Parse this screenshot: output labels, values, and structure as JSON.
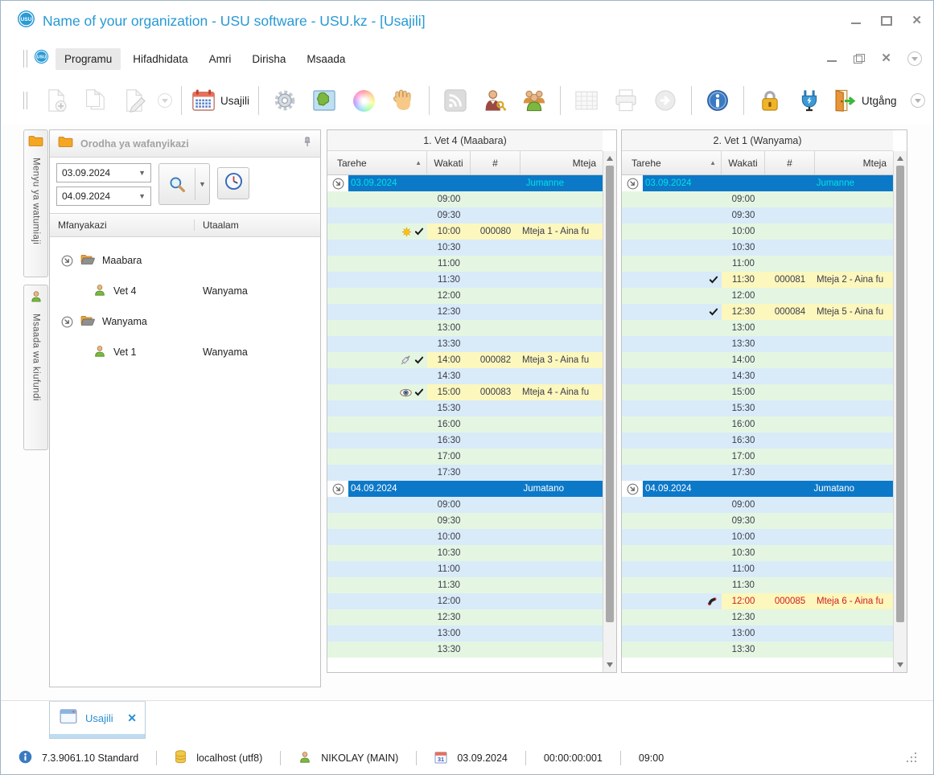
{
  "window": {
    "title": "Name of your organization - USU software - USU.kz - [Usajili]"
  },
  "menubar": {
    "items": [
      "Programu",
      "Hifadhidata",
      "Amri",
      "Dirisha",
      "Msaada"
    ],
    "active": "Programu"
  },
  "toolbar": {
    "usajili_label": "Usajili",
    "exit_label": "Utgång"
  },
  "vertical_tabs": [
    "Menyu ya watumiaji",
    "Msaada wa kiufundi"
  ],
  "sidebar": {
    "title": "Orodha ya wafanyikazi",
    "date_from": "03.09.2024",
    "date_to": "04.09.2024",
    "columns": [
      "Mfanyakazi",
      "Utaalam"
    ],
    "tree": [
      {
        "group": "Maabara",
        "members": [
          {
            "name": "Vet 4",
            "specialty": "Wanyama"
          }
        ]
      },
      {
        "group": "Wanyama",
        "members": [
          {
            "name": "Vet 1",
            "specialty": "Wanyama"
          }
        ]
      }
    ]
  },
  "schedule": {
    "columns": [
      "Tarehe",
      "Wakati",
      "#",
      "Mteja"
    ],
    "panels": [
      {
        "title": "1. Vet 4 (Maabara)",
        "days": [
          {
            "date": "03.09.2024",
            "weekday": "Jumanne",
            "selected": true,
            "slots": [
              {
                "time": "09:00"
              },
              {
                "time": "09:30"
              },
              {
                "time": "10:00",
                "number": "000080",
                "client": "Mteja 1 - Aina fu",
                "icons": [
                  "star",
                  "check"
                ]
              },
              {
                "time": "10:30"
              },
              {
                "time": "11:00"
              },
              {
                "time": "11:30"
              },
              {
                "time": "12:00"
              },
              {
                "time": "12:30"
              },
              {
                "time": "13:00"
              },
              {
                "time": "13:30"
              },
              {
                "time": "14:00",
                "number": "000082",
                "client": "Mteja 3 - Aina fu",
                "icons": [
                  "syringe",
                  "check"
                ]
              },
              {
                "time": "14:30"
              },
              {
                "time": "15:00",
                "number": "000083",
                "client": "Mteja 4 - Aina fu",
                "icons": [
                  "eye",
                  "check"
                ]
              },
              {
                "time": "15:30"
              },
              {
                "time": "16:00"
              },
              {
                "time": "16:30"
              },
              {
                "time": "17:00"
              },
              {
                "time": "17:30"
              }
            ]
          },
          {
            "date": "04.09.2024",
            "weekday": "Jumatano",
            "selected": false,
            "slots": [
              {
                "time": "09:00"
              },
              {
                "time": "09:30"
              },
              {
                "time": "10:00"
              },
              {
                "time": "10:30"
              },
              {
                "time": "11:00"
              },
              {
                "time": "11:30"
              },
              {
                "time": "12:00"
              },
              {
                "time": "12:30"
              },
              {
                "time": "13:00"
              },
              {
                "time": "13:30"
              }
            ]
          }
        ]
      },
      {
        "title": "2. Vet 1 (Wanyama)",
        "days": [
          {
            "date": "03.09.2024",
            "weekday": "Jumanne",
            "selected": true,
            "slots": [
              {
                "time": "09:00"
              },
              {
                "time": "09:30"
              },
              {
                "time": "10:00"
              },
              {
                "time": "10:30"
              },
              {
                "time": "11:00"
              },
              {
                "time": "11:30",
                "number": "000081",
                "client": "Mteja 2 - Aina fu",
                "icons": [
                  "check"
                ]
              },
              {
                "time": "12:00"
              },
              {
                "time": "12:30",
                "number": "000084",
                "client": "Mteja 5 - Aina fu",
                "icons": [
                  "check"
                ]
              },
              {
                "time": "13:00"
              },
              {
                "time": "13:30"
              },
              {
                "time": "14:00"
              },
              {
                "time": "14:30"
              },
              {
                "time": "15:00"
              },
              {
                "time": "15:30"
              },
              {
                "time": "16:00"
              },
              {
                "time": "16:30"
              },
              {
                "time": "17:00"
              },
              {
                "time": "17:30"
              }
            ]
          },
          {
            "date": "04.09.2024",
            "weekday": "Jumatano",
            "selected": false,
            "slots": [
              {
                "time": "09:00"
              },
              {
                "time": "09:30"
              },
              {
                "time": "10:00"
              },
              {
                "time": "10:30"
              },
              {
                "time": "11:00"
              },
              {
                "time": "11:30"
              },
              {
                "time": "12:00",
                "number": "000085",
                "client": "Mteja 6 - Aina fu",
                "icons": [
                  "phone"
                ],
                "alert": true
              },
              {
                "time": "12:30"
              },
              {
                "time": "13:00"
              },
              {
                "time": "13:30"
              }
            ]
          }
        ]
      }
    ]
  },
  "tabbar": {
    "active_tab": "Usajili"
  },
  "statusbar": {
    "version": "7.3.9061.10 Standard",
    "database": "localhost (utf8)",
    "user": "NIKOLAY (MAIN)",
    "date": "03.09.2024",
    "timer": "00:00:00:001",
    "time": "09:00"
  },
  "colors": {
    "title_text": "#2799d4",
    "day_bar": "#0c78c8",
    "selected_day_text": "#00e2e2",
    "row_green": "#e4f6e2",
    "row_blue": "#d9ebf9",
    "appointment_bg": "#fcf7bd",
    "alert_text": "#cc1f1f"
  }
}
